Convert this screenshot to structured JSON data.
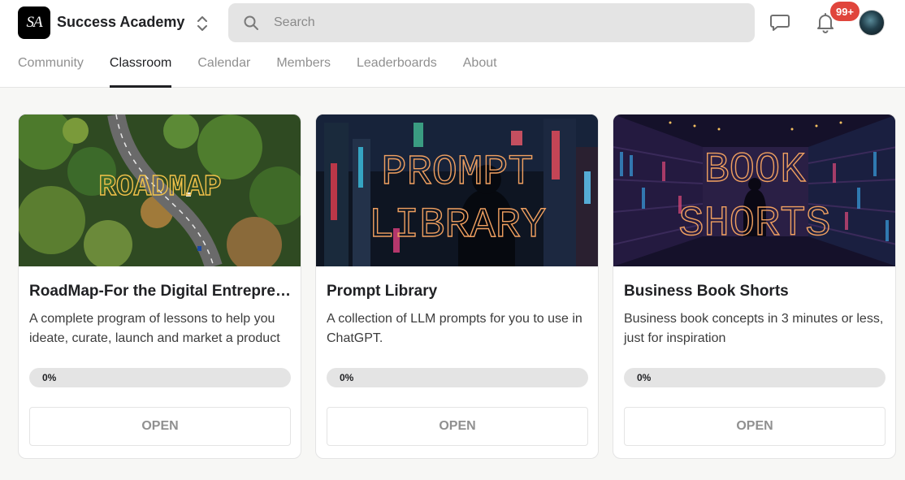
{
  "brand": {
    "logo_text": "SA",
    "name": "Success Academy"
  },
  "search": {
    "placeholder": "Search"
  },
  "notifications": {
    "badge": "99+"
  },
  "tabs": [
    {
      "label": "Community",
      "active": false
    },
    {
      "label": "Classroom",
      "active": true
    },
    {
      "label": "Calendar",
      "active": false
    },
    {
      "label": "Members",
      "active": false
    },
    {
      "label": "Leaderboards",
      "active": false
    },
    {
      "label": "About",
      "active": false
    }
  ],
  "courses": [
    {
      "cover_text": [
        "ROADMAP"
      ],
      "title": "RoadMap-For the Digital Entrepreneur",
      "description": "A complete program of lessons to help you ideate, curate, launch and market a product",
      "progress": 0,
      "progress_label": "0%",
      "button": "OPEN"
    },
    {
      "cover_text": [
        "PROMPT",
        "LIBRARY"
      ],
      "title": "Prompt Library",
      "description": "A collection of LLM prompts for you to use in ChatGPT.",
      "progress": 0,
      "progress_label": "0%",
      "button": "OPEN"
    },
    {
      "cover_text": [
        "BOOK",
        "SHORTS"
      ],
      "title": "Business Book Shorts",
      "description": "Business book concepts in 3 minutes or less, just for inspiration",
      "progress": 0,
      "progress_label": "0%",
      "button": "OPEN"
    }
  ],
  "colors": {
    "accent": "#202124",
    "badge": "#e0453c",
    "neon_outline": "#f0a060",
    "progress_fill": "#e8b83c"
  }
}
